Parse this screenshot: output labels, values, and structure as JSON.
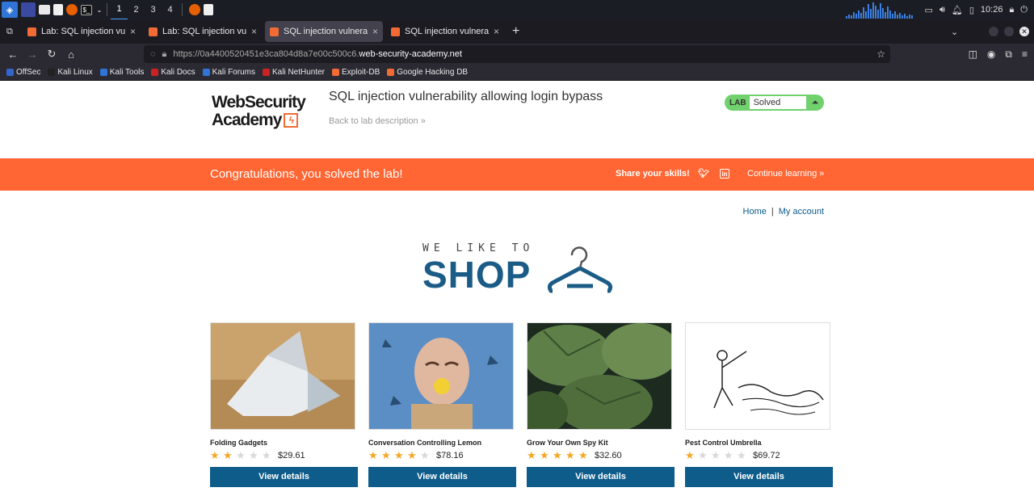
{
  "taskbar": {
    "workspaces": [
      "1",
      "2",
      "3",
      "4"
    ],
    "active_workspace": "1",
    "clock": "10:26"
  },
  "browser": {
    "tabs": [
      {
        "label": "Lab: SQL injection vulnera",
        "active": false
      },
      {
        "label": "Lab: SQL injection vulnera",
        "active": false
      },
      {
        "label": "SQL injection vulnerability",
        "active": true
      },
      {
        "label": "SQL injection vulnerability",
        "active": false
      }
    ],
    "url_prefix": "https://0a4400520451e3ca804d8a7e00c500c6.",
    "url_host": "web-security-academy.net",
    "bookmarks": [
      {
        "label": "OffSec",
        "color": "#3366cc"
      },
      {
        "label": "Kali Linux",
        "color": "#222222"
      },
      {
        "label": "Kali Tools",
        "color": "#2f74d6"
      },
      {
        "label": "Kali Docs",
        "color": "#cc2222"
      },
      {
        "label": "Kali Forums",
        "color": "#2f74d6"
      },
      {
        "label": "Kali NetHunter",
        "color": "#cc2222"
      },
      {
        "label": "Exploit-DB",
        "color": "#f26b35"
      },
      {
        "label": "Google Hacking DB",
        "color": "#f26b35"
      }
    ]
  },
  "header": {
    "logo_line1": "WebSecurity",
    "logo_line2": "Academy",
    "lab_title": "SQL injection vulnerability allowing login bypass",
    "back_link": "Back to lab description »",
    "lab_badge": "LAB",
    "lab_status": "Solved"
  },
  "banner": {
    "message": "Congratulations, you solved the lab!",
    "share": "Share your skills!",
    "continue": "Continue learning »"
  },
  "nav": {
    "home": "Home",
    "separator": "|",
    "account": "My account"
  },
  "shop": {
    "tagline": "WE LIKE TO",
    "title": "SHOP"
  },
  "products": [
    {
      "name": "Folding Gadgets",
      "rating": 2,
      "price": "$29.61",
      "button": "View details"
    },
    {
      "name": "Conversation Controlling Lemon",
      "rating": 4,
      "price": "$78.16",
      "button": "View details"
    },
    {
      "name": "Grow Your Own Spy Kit",
      "rating": 5,
      "price": "$32.60",
      "button": "View details"
    },
    {
      "name": "Pest Control Umbrella",
      "rating": 1,
      "price": "$69.72",
      "button": "View details"
    }
  ],
  "colors": {
    "banner": "#ff6633",
    "button": "#0e5c8a",
    "solved": "#70d16d",
    "star": "#f5a623"
  }
}
